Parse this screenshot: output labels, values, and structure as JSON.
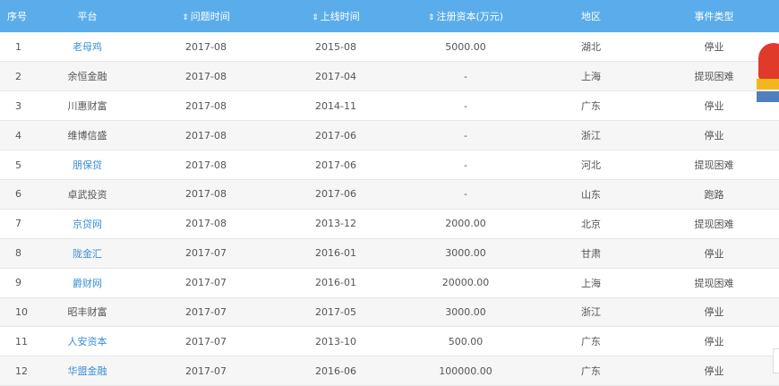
{
  "header": {
    "index": "序号",
    "platform": "平台",
    "issue_date": "问题时间",
    "launch_date": "上线时间",
    "capital": "注册资本(万元)",
    "region": "地区",
    "event_type": "事件类型"
  },
  "icons": {
    "sort": "sort-arrows-icon"
  },
  "colors": {
    "header_bg": "#5aadea",
    "link": "#3a8fd6",
    "row_alt": "#f6f6f6"
  },
  "rows": [
    {
      "index": "1",
      "platform": "老母鸡",
      "link": true,
      "issue_date": "2017-08",
      "launch_date": "2015-08",
      "capital": "5000.00",
      "region": "湖北",
      "event_type": "停业"
    },
    {
      "index": "2",
      "platform": "余恒金融",
      "link": false,
      "issue_date": "2017-08",
      "launch_date": "2017-04",
      "capital": "-",
      "region": "上海",
      "event_type": "提现困难"
    },
    {
      "index": "3",
      "platform": "川惠财富",
      "link": false,
      "issue_date": "2017-08",
      "launch_date": "2014-11",
      "capital": "-",
      "region": "广东",
      "event_type": "停业"
    },
    {
      "index": "4",
      "platform": "维博信盛",
      "link": false,
      "issue_date": "2017-08",
      "launch_date": "2017-06",
      "capital": "-",
      "region": "浙江",
      "event_type": "停业"
    },
    {
      "index": "5",
      "platform": "朋保贷",
      "link": true,
      "issue_date": "2017-08",
      "launch_date": "2017-06",
      "capital": "-",
      "region": "河北",
      "event_type": "提现困难"
    },
    {
      "index": "6",
      "platform": "卓武投资",
      "link": false,
      "issue_date": "2017-08",
      "launch_date": "2017-06",
      "capital": "-",
      "region": "山东",
      "event_type": "跑路"
    },
    {
      "index": "7",
      "platform": "京贷网",
      "link": true,
      "issue_date": "2017-08",
      "launch_date": "2013-12",
      "capital": "2000.00",
      "region": "北京",
      "event_type": "提现困难"
    },
    {
      "index": "8",
      "platform": "陇金汇",
      "link": true,
      "issue_date": "2017-07",
      "launch_date": "2016-01",
      "capital": "3000.00",
      "region": "甘肃",
      "event_type": "停业"
    },
    {
      "index": "9",
      "platform": "爵财网",
      "link": true,
      "issue_date": "2017-07",
      "launch_date": "2016-01",
      "capital": "20000.00",
      "region": "上海",
      "event_type": "提现困难"
    },
    {
      "index": "10",
      "platform": "昭丰财富",
      "link": false,
      "issue_date": "2017-07",
      "launch_date": "2017-05",
      "capital": "3000.00",
      "region": "浙江",
      "event_type": "停业"
    },
    {
      "index": "11",
      "platform": "人安资本",
      "link": true,
      "issue_date": "2017-07",
      "launch_date": "2013-10",
      "capital": "500.00",
      "region": "广东",
      "event_type": "停业"
    },
    {
      "index": "12",
      "platform": "华盟金融",
      "link": true,
      "issue_date": "2017-07",
      "launch_date": "2016-06",
      "capital": "100000.00",
      "region": "广东",
      "event_type": "停业"
    }
  ]
}
